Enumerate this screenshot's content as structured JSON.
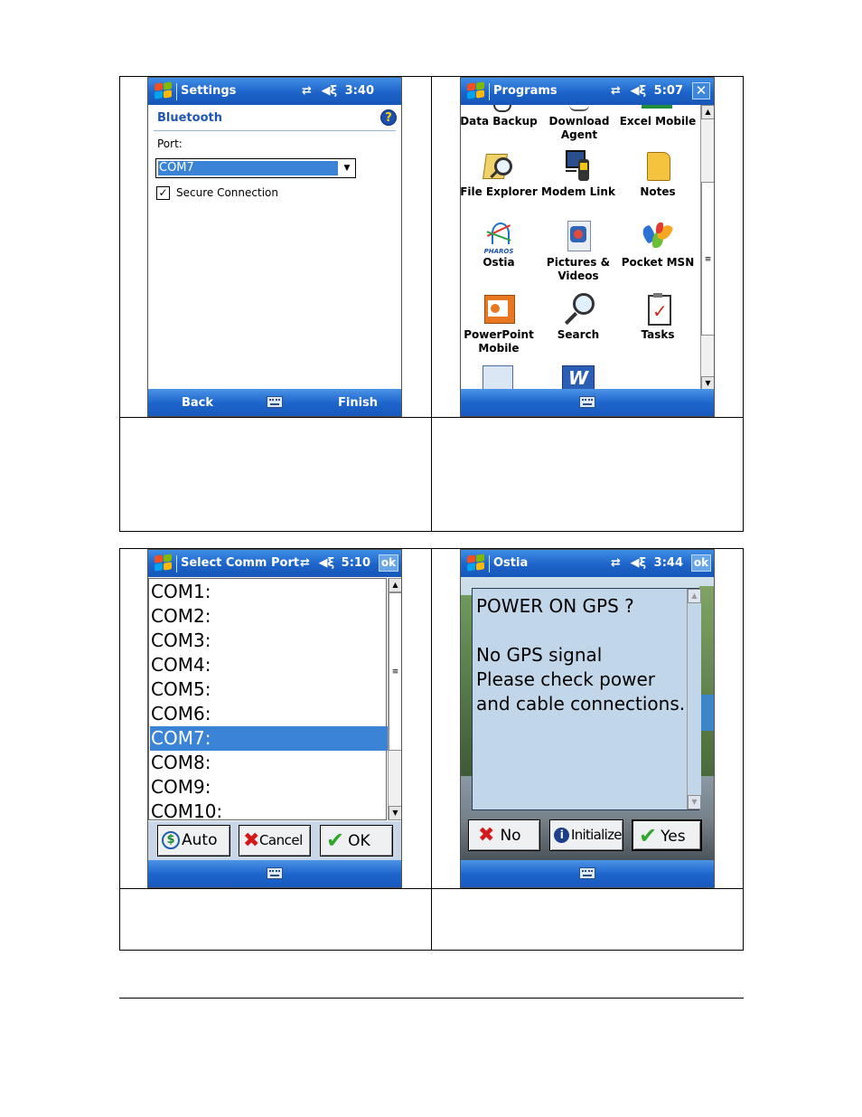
{
  "screens": {
    "settings": {
      "title": "Settings",
      "time": "3:40",
      "heading": "Bluetooth",
      "port_label": "Port:",
      "port_value": "COM7",
      "secure_label": "Secure Connection",
      "back_label": "Back",
      "finish_label": "Finish",
      "icons": [
        "windows-flag-icon",
        "connectivity-icon",
        "speaker-icon",
        "help-icon",
        "keyboard-icon"
      ]
    },
    "programs": {
      "title": "Programs",
      "time": "5:07",
      "close_label": "✕",
      "items": [
        {
          "label": "Data Backup",
          "icon": "data-backup-icon"
        },
        {
          "label": "Download Agent",
          "icon": "download-agent-icon"
        },
        {
          "label": "Excel Mobile",
          "icon": "excel-mobile-icon"
        },
        {
          "label": "File Explorer",
          "icon": "file-explorer-icon"
        },
        {
          "label": "Modem Link",
          "icon": "modem-link-icon"
        },
        {
          "label": "Notes",
          "icon": "notes-icon"
        },
        {
          "label": "Ostia",
          "icon": "ostia-icon"
        },
        {
          "label": "Pictures & Videos",
          "icon": "pictures-videos-icon"
        },
        {
          "label": "Pocket MSN",
          "icon": "pocket-msn-icon"
        },
        {
          "label": "PowerPoint Mobile",
          "icon": "powerpoint-mobile-icon"
        },
        {
          "label": "Search",
          "icon": "search-icon"
        },
        {
          "label": "Tasks",
          "icon": "tasks-icon"
        }
      ],
      "pharos_text": "PHAROS"
    },
    "select_comm": {
      "title": "Select Comm Port",
      "time": "5:10",
      "ok_label": "ok",
      "ports": [
        "COM1:",
        "COM2:",
        "COM3:",
        "COM4:",
        "COM5:",
        "COM6:",
        "COM7:",
        "COM8:",
        "COM9:",
        "COM10:"
      ],
      "selected": "COM7:",
      "auto_label": "Auto",
      "cancel_label": "Cancel",
      "ok_button_label": "OK"
    },
    "ostia": {
      "title": "Ostia",
      "time": "3:44",
      "ok_label": "ok",
      "message": [
        "POWER ON GPS ?",
        "",
        "No GPS signal",
        "Please check power",
        "and cable connections."
      ],
      "no_label": "No",
      "initialize_label": "Initialize",
      "yes_label": "Yes"
    }
  },
  "colors": {
    "titlebar": "#1d63c9",
    "selection": "#3a83d6",
    "heading": "#1f57b3",
    "message_box": "#c2d6e9"
  }
}
